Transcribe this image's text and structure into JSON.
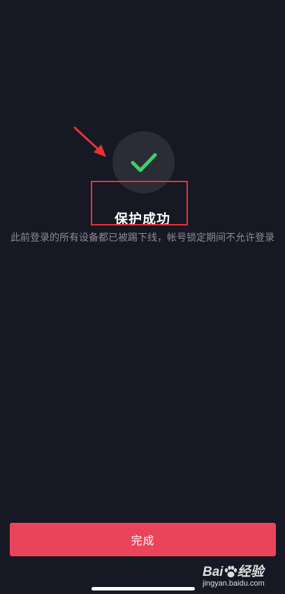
{
  "status": {
    "title": "保护成功",
    "description": "此前登录的所有设备都已被踢下线，帐号锁定期间不允许登录",
    "icon": "checkmark-icon",
    "icon_color": "#3fcf6b"
  },
  "actions": {
    "done_label": "完成",
    "done_color": "#ea445a"
  },
  "watermark": {
    "brand_left": "Bai",
    "brand_right": "经验",
    "site": "jingyan.baidu.com"
  },
  "annotation": {
    "color": "#e8313a"
  }
}
